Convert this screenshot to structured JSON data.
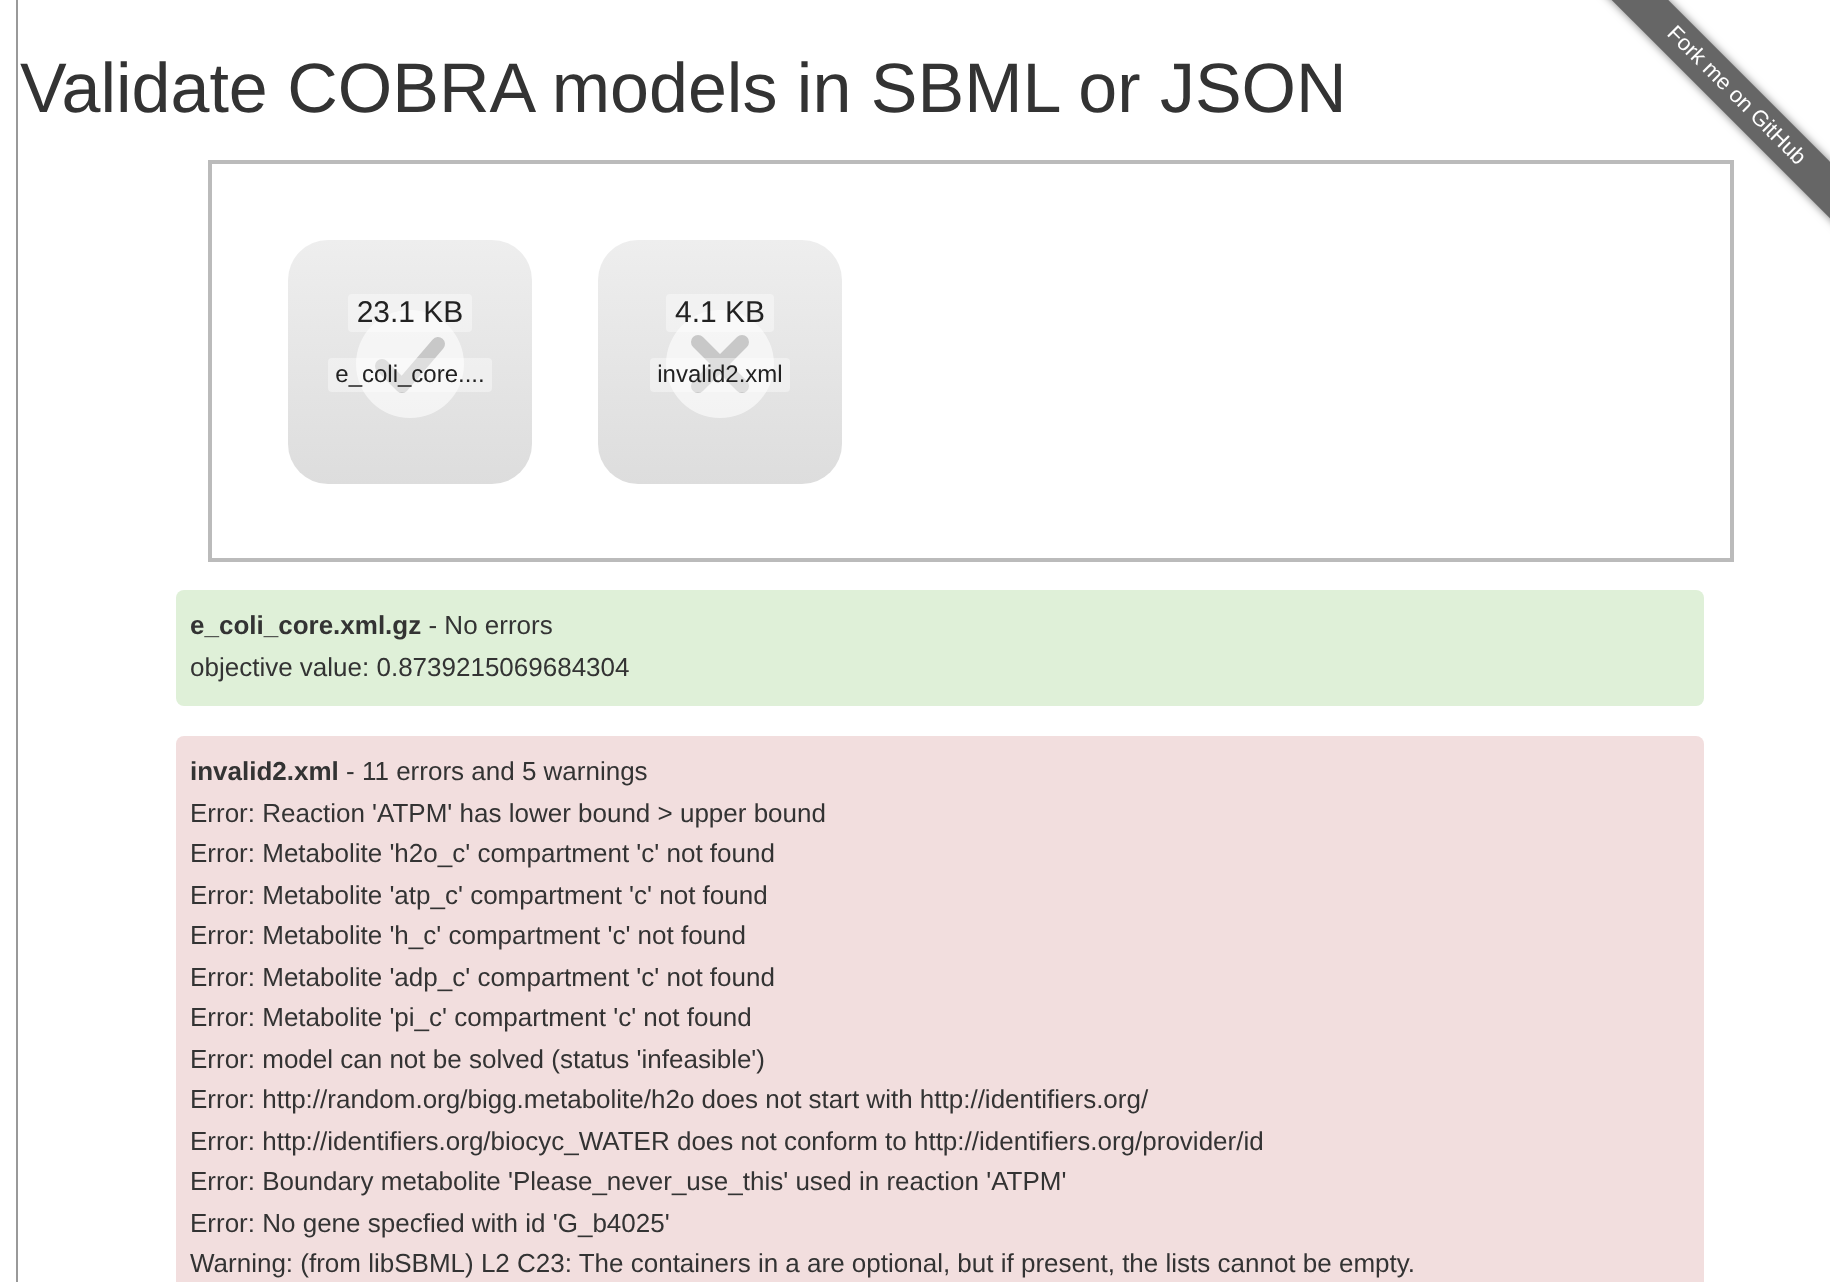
{
  "title": "Validate COBRA models in SBML or JSON",
  "ribbon": "Fork me on GitHub",
  "files": [
    {
      "size": "23.1 KB",
      "name": "e_coli_core....",
      "valid": true
    },
    {
      "size": "4.1 KB",
      "name": "invalid2.xml",
      "valid": false
    }
  ],
  "results": [
    {
      "kind": "success",
      "filename": "e_coli_core.xml.gz",
      "summary": " - No errors",
      "lines": [
        "objective value: 0.8739215069684304"
      ]
    },
    {
      "kind": "error",
      "filename": "invalid2.xml",
      "summary": " - 11 errors and 5 warnings",
      "lines": [
        "Error: Reaction 'ATPM' has lower bound > upper bound",
        "Error: Metabolite 'h2o_c' compartment 'c' not found",
        "Error: Metabolite 'atp_c' compartment 'c' not found",
        "Error: Metabolite 'h_c' compartment 'c' not found",
        "Error: Metabolite 'adp_c' compartment 'c' not found",
        "Error: Metabolite 'pi_c' compartment 'c' not found",
        "Error: model can not be solved (status 'infeasible')",
        "Error: http://random.org/bigg.metabolite/h2o does not start with http://identifiers.org/",
        "Error: http://identifiers.org/biocyc_WATER does not conform to http://identifiers.org/provider/id",
        "Error: Boundary metabolite 'Please_never_use_this' used in reaction 'ATPM'",
        "Error: No gene specfied with id 'G_b4025'",
        "Warning: (from libSBML) L2 C23: The containers in a are optional, but if present, the lists cannot be empty."
      ]
    }
  ]
}
